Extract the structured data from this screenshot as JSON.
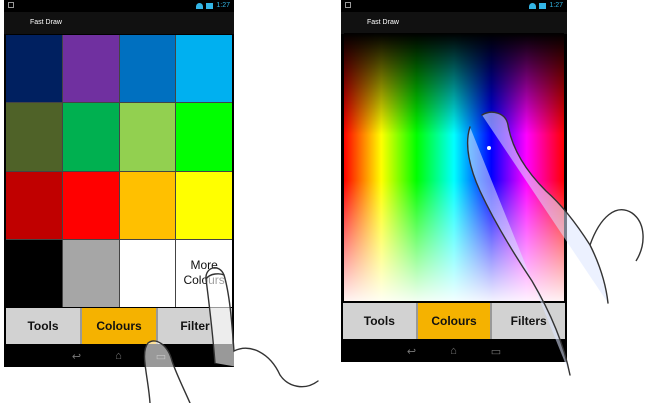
{
  "left_screen": {
    "action_bar_title": "Fast Draw",
    "status_time": "1:27",
    "swatches": [
      {
        "color": "#002060"
      },
      {
        "color": "#7030a0"
      },
      {
        "color": "#0070c0"
      },
      {
        "color": "#00b0f0"
      },
      {
        "color": "#4f6228"
      },
      {
        "color": "#00b050"
      },
      {
        "color": "#92d050"
      },
      {
        "color": "#00ff00"
      },
      {
        "color": "#c00000"
      },
      {
        "color": "#ff0000"
      },
      {
        "color": "#ffc000"
      },
      {
        "color": "#ffff00"
      },
      {
        "color": "#000000"
      },
      {
        "color": "#a6a6a6"
      },
      {
        "color": "#ffffff"
      }
    ],
    "more_colours_line1": "More",
    "more_colours_line2": "Colours",
    "tabs": [
      {
        "label": "Tools",
        "active": false
      },
      {
        "label": "Colours",
        "active": true
      },
      {
        "label": "Filter",
        "active": false
      }
    ]
  },
  "right_screen": {
    "action_bar_title": "Fast Draw",
    "status_time": "1:27",
    "tabs": [
      {
        "label": "Tools",
        "active": false
      },
      {
        "label": "Colours",
        "active": true
      },
      {
        "label": "Filters",
        "active": false
      }
    ]
  },
  "colors": {
    "active_tab": "#f5b200",
    "inactive_tab": "#d2d2d2",
    "status_icons": "#33b5e5"
  },
  "icons": {
    "nav": [
      "back-icon",
      "home-icon",
      "recents-icon"
    ]
  }
}
